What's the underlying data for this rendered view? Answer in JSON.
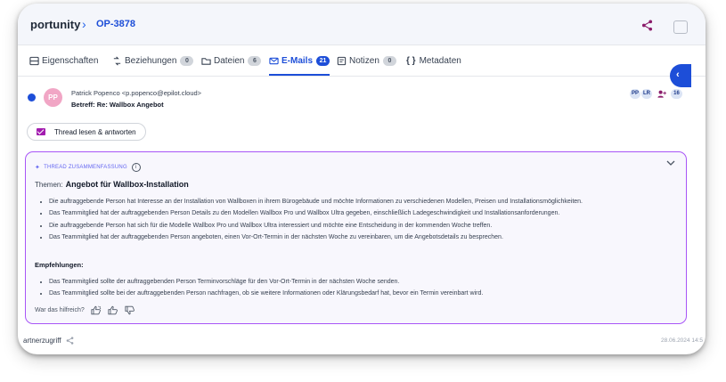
{
  "header": {
    "title": "portunity",
    "separator": "›",
    "record_id": "OP-3878",
    "share_icon": "share-icon"
  },
  "tabs": [
    {
      "label": "Eigenschaften",
      "icon": "layout-icon",
      "badge": ""
    },
    {
      "label": "Beziehungen",
      "icon": "relations-icon",
      "badge": "0"
    },
    {
      "label": "Dateien",
      "icon": "folder-icon",
      "badge": "6"
    },
    {
      "label": "E-Mails",
      "icon": "mail-icon",
      "badge": "21",
      "active": true
    },
    {
      "label": "Notizen",
      "icon": "note-icon",
      "badge": "0"
    },
    {
      "label": "Metadaten",
      "icon": "braces-icon",
      "badge": ""
    }
  ],
  "email": {
    "avatar": "PP",
    "sender": "Patrick Popenco <p.popenco@epilot.cloud>",
    "subject": "Betreff: Re: Wallbox Angebot",
    "chips": [
      "PP",
      "LR",
      "16"
    ],
    "thread_button": "Thread lesen & antworten"
  },
  "summary": {
    "heading": "THREAD ZUSAMMENFASSUNG",
    "theme_label": "Themen:",
    "theme_value": "Angebot für Wallbox-Installation",
    "points": [
      "Die auftraggebende Person hat Interesse an der Installation von Wallboxen in ihrem Bürogebäude und möchte Informationen zu verschiedenen Modellen, Preisen und Installationsmöglichkeiten.",
      "Das Teammitglied hat der auftraggebenden Person Details zu den Modellen Wallbox Pro und Wallbox Ultra gegeben, einschließlich Ladegeschwindigkeit und Installationsanforderungen.",
      "Die auftraggebende Person hat sich für die Modelle Wallbox Pro und Wallbox Ultra interessiert und möchte eine Entscheidung in der kommenden Woche treffen.",
      "Das Teammitglied hat der auftraggebenden Person angeboten, einen Vor-Ort-Termin in der nächsten Woche zu vereinbaren, um die Angebotsdetails zu besprechen."
    ],
    "recommendations_label": "Empfehlungen:",
    "recommendations": [
      "Das Teammitglied sollte der auftraggebenden Person Terminvorschläge für den Vor-Ort-Termin in der nächsten Woche senden.",
      "Das Teammitglied sollte bei der auftraggebenden Person nachfragen, ob sie weitere Informationen oder Klärungsbedarf hat, bevor ein Termin vereinbart wird."
    ],
    "helpful_label": "War das hilfreich?"
  },
  "footer": {
    "partner_label": "artnerzugriff",
    "date": "28.06.2024 14:5"
  },
  "colors": {
    "accent": "#1d4ed8",
    "summary_border": "#a855f7",
    "avatar": "#f1a6c5"
  }
}
